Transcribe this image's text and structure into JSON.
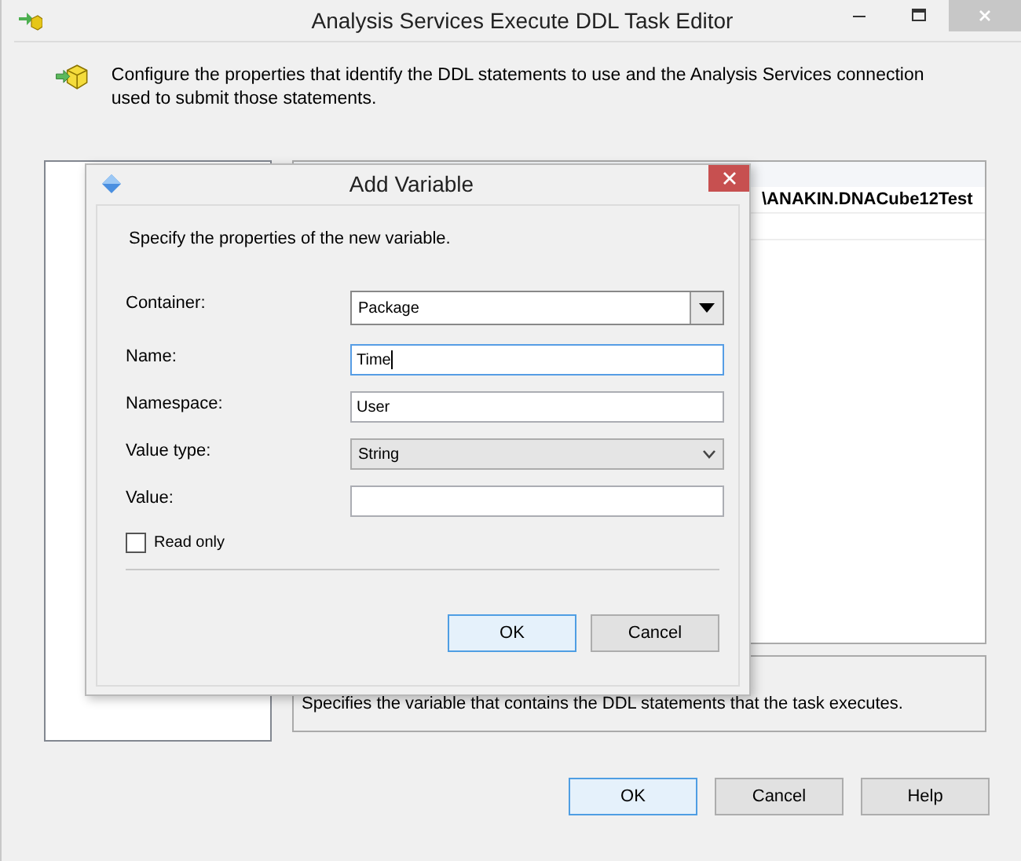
{
  "window": {
    "title": "Analysis Services Execute DDL Task Editor",
    "description": "Configure the properties that identify the DDL statements to use and the Analysis Services connection used to submit those statements."
  },
  "grid": {
    "rows": [
      "\\ANAKIN.DNACube12Test"
    ]
  },
  "description_box": "Specifies the variable that contains the DDL statements that the task executes.",
  "buttons": [
    "OK",
    "Cancel",
    "Help"
  ],
  "dialog": {
    "title": "Add Variable",
    "intro": "Specify the properties of the new variable.",
    "fields": [
      {
        "label": "Container:",
        "kind": "combo",
        "value": "Package"
      },
      {
        "label": "Name:",
        "kind": "text",
        "value": "Time",
        "focused": true
      },
      {
        "label": "Namespace:",
        "kind": "text",
        "value": "User",
        "focused": false
      },
      {
        "label": "Value type:",
        "kind": "dropdown",
        "value": "String"
      },
      {
        "label": "Value:",
        "kind": "text",
        "focused": false
      }
    ],
    "read_only": {
      "label": "Read only",
      "checked": false
    },
    "buttons": [
      {
        "label": "OK",
        "default": true
      },
      {
        "label": "Cancel",
        "default": false
      }
    ]
  }
}
